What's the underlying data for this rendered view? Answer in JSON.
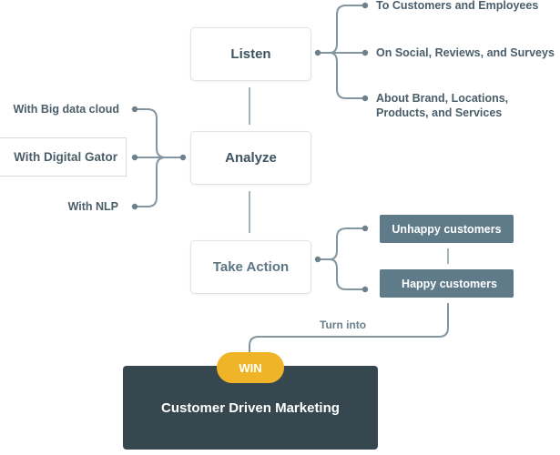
{
  "steps": {
    "listen": "Listen",
    "analyze": "Analyze",
    "take_action": "Take Action"
  },
  "listen_targets": [
    "To Customers and Employees",
    "On Social, Reviews, and Surveys",
    "About Brand, Locations, Products, and Services"
  ],
  "analyze_sources": [
    "With Big data cloud",
    "With Digital Gator",
    "With NLP"
  ],
  "action_outcomes": [
    "Unhappy customers",
    "Happy customers"
  ],
  "transition_label": "Turn into",
  "result": {
    "badge": "WIN",
    "title": "Customer Driven Marketing"
  },
  "colors": {
    "connector": "#8295a0",
    "outcome_box": "#5f7b89",
    "result_box": "#37474f",
    "badge": "#f0b429",
    "text": "#3e5360"
  }
}
